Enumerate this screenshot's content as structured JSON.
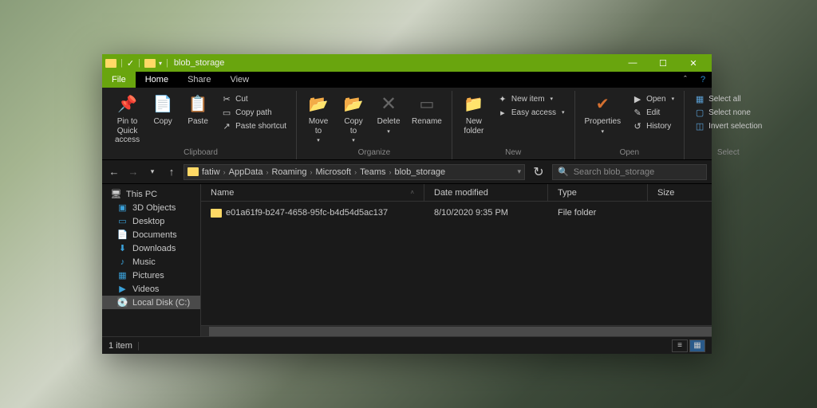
{
  "titlebar": {
    "title": "blob_storage"
  },
  "tabs": {
    "file": "File",
    "home": "Home",
    "share": "Share",
    "view": "View"
  },
  "ribbon": {
    "clipboard": {
      "label": "Clipboard",
      "pin": "Pin to Quick\naccess",
      "copy": "Copy",
      "paste": "Paste",
      "cut": "Cut",
      "copypath": "Copy path",
      "pasteshortcut": "Paste shortcut"
    },
    "organize": {
      "label": "Organize",
      "moveto": "Move\nto",
      "copyto": "Copy\nto",
      "delete": "Delete",
      "rename": "Rename"
    },
    "new_grp": {
      "label": "New",
      "newfolder": "New\nfolder",
      "newitem": "New item",
      "easyaccess": "Easy access"
    },
    "open_grp": {
      "label": "Open",
      "properties": "Properties",
      "open": "Open",
      "edit": "Edit",
      "history": "History"
    },
    "select": {
      "label": "Select",
      "selectall": "Select all",
      "selectnone": "Select none",
      "invert": "Invert selection"
    }
  },
  "breadcrumbs": [
    "fatiw",
    "AppData",
    "Roaming",
    "Microsoft",
    "Teams",
    "blob_storage"
  ],
  "search": {
    "placeholder": "Search blob_storage"
  },
  "sidebar": {
    "root": "This PC",
    "items": [
      "3D Objects",
      "Desktop",
      "Documents",
      "Downloads",
      "Music",
      "Pictures",
      "Videos",
      "Local Disk (C:)"
    ]
  },
  "columns": {
    "name": "Name",
    "date": "Date modified",
    "type": "Type",
    "size": "Size"
  },
  "rows": [
    {
      "name": "e01a61f9-b247-4658-95fc-b4d54d5ac137",
      "date": "8/10/2020 9:35 PM",
      "type": "File folder",
      "size": ""
    }
  ],
  "status": {
    "count": "1 item"
  },
  "colors": {
    "accent": "#69a50e"
  }
}
